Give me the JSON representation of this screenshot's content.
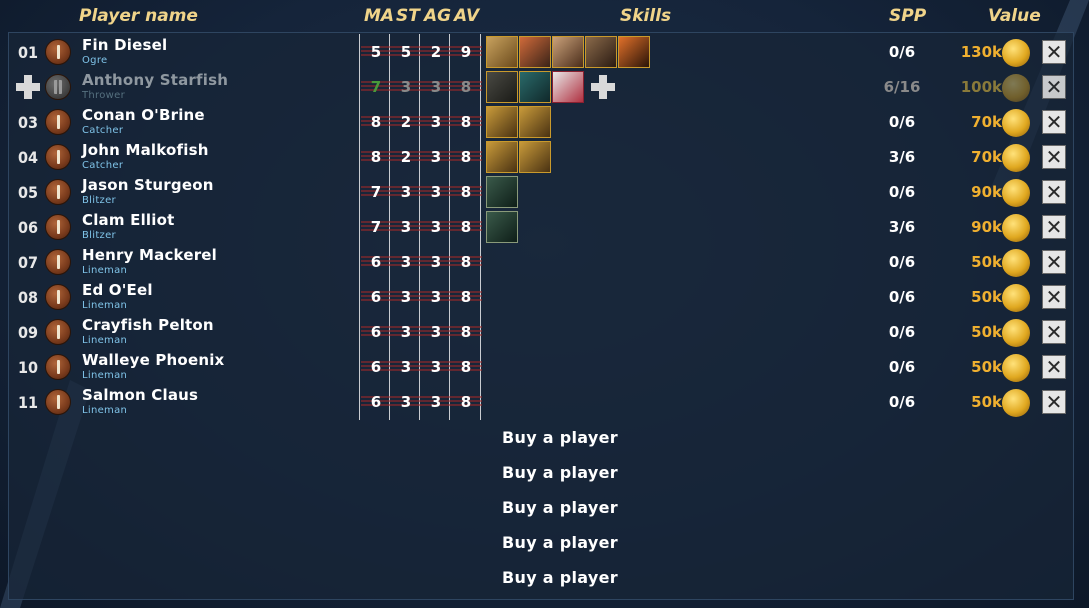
{
  "header": {
    "player_name": "Player name",
    "ma": "MA",
    "st": "ST",
    "ag": "AG",
    "av": "AV",
    "skills": "Skills",
    "spp": "SPP",
    "value": "Value"
  },
  "players": [
    {
      "num": "01",
      "name": "Fin Diesel",
      "position": "Ogre",
      "ma": "5",
      "st": "5",
      "ag": "2",
      "av": "9",
      "spp": "0/6",
      "value": "130k",
      "skills": [
        "skill-icon-a",
        "skill-icon-b",
        "skill-icon-c",
        "skill-icon-d",
        "skill-icon-e"
      ]
    },
    {
      "num": "",
      "name": "Anthony Starfish",
      "position": "Thrower",
      "ma": "7",
      "st": "3",
      "ag": "3",
      "av": "8",
      "spp": "6/16",
      "value": "100k",
      "injured": true,
      "skills": [
        "skill-icon-f",
        "skill-icon-g",
        "skill-icon-h"
      ]
    },
    {
      "num": "03",
      "name": "Conan O'Brine",
      "position": "Catcher",
      "ma": "8",
      "st": "2",
      "ag": "3",
      "av": "8",
      "spp": "0/6",
      "value": "70k",
      "skills": [
        "skill-icon-i",
        "skill-icon-i"
      ]
    },
    {
      "num": "04",
      "name": "John Malkofish",
      "position": "Catcher",
      "ma": "8",
      "st": "2",
      "ag": "3",
      "av": "8",
      "spp": "3/6",
      "value": "70k",
      "skills": [
        "skill-icon-i",
        "skill-icon-i"
      ]
    },
    {
      "num": "05",
      "name": "Jason Sturgeon",
      "position": "Blitzer",
      "ma": "7",
      "st": "3",
      "ag": "3",
      "av": "8",
      "spp": "0/6",
      "value": "90k",
      "skills": [
        "skill-icon-j"
      ]
    },
    {
      "num": "06",
      "name": "Clam Elliot",
      "position": "Blitzer",
      "ma": "7",
      "st": "3",
      "ag": "3",
      "av": "8",
      "spp": "3/6",
      "value": "90k",
      "skills": [
        "skill-icon-j"
      ]
    },
    {
      "num": "07",
      "name": "Henry Mackerel",
      "position": "Lineman",
      "ma": "6",
      "st": "3",
      "ag": "3",
      "av": "8",
      "spp": "0/6",
      "value": "50k",
      "skills": []
    },
    {
      "num": "08",
      "name": "Ed O'Eel",
      "position": "Lineman",
      "ma": "6",
      "st": "3",
      "ag": "3",
      "av": "8",
      "spp": "0/6",
      "value": "50k",
      "skills": []
    },
    {
      "num": "09",
      "name": "Crayfish Pelton",
      "position": "Lineman",
      "ma": "6",
      "st": "3",
      "ag": "3",
      "av": "8",
      "spp": "0/6",
      "value": "50k",
      "skills": []
    },
    {
      "num": "10",
      "name": "Walleye Phoenix",
      "position": "Lineman",
      "ma": "6",
      "st": "3",
      "ag": "3",
      "av": "8",
      "spp": "0/6",
      "value": "50k",
      "skills": []
    },
    {
      "num": "11",
      "name": "Salmon Claus",
      "position": "Lineman",
      "ma": "6",
      "st": "3",
      "ag": "3",
      "av": "8",
      "spp": "0/6",
      "value": "50k",
      "skills": []
    }
  ],
  "buy_slots": [
    "Buy a player",
    "Buy a player",
    "Buy a player",
    "Buy a player",
    "Buy a player"
  ],
  "colors": {
    "header_text": "#f0d48a",
    "value_gold": "#f0b030",
    "position_blue": "#7fc3e8",
    "panel_bg": "#182638"
  }
}
